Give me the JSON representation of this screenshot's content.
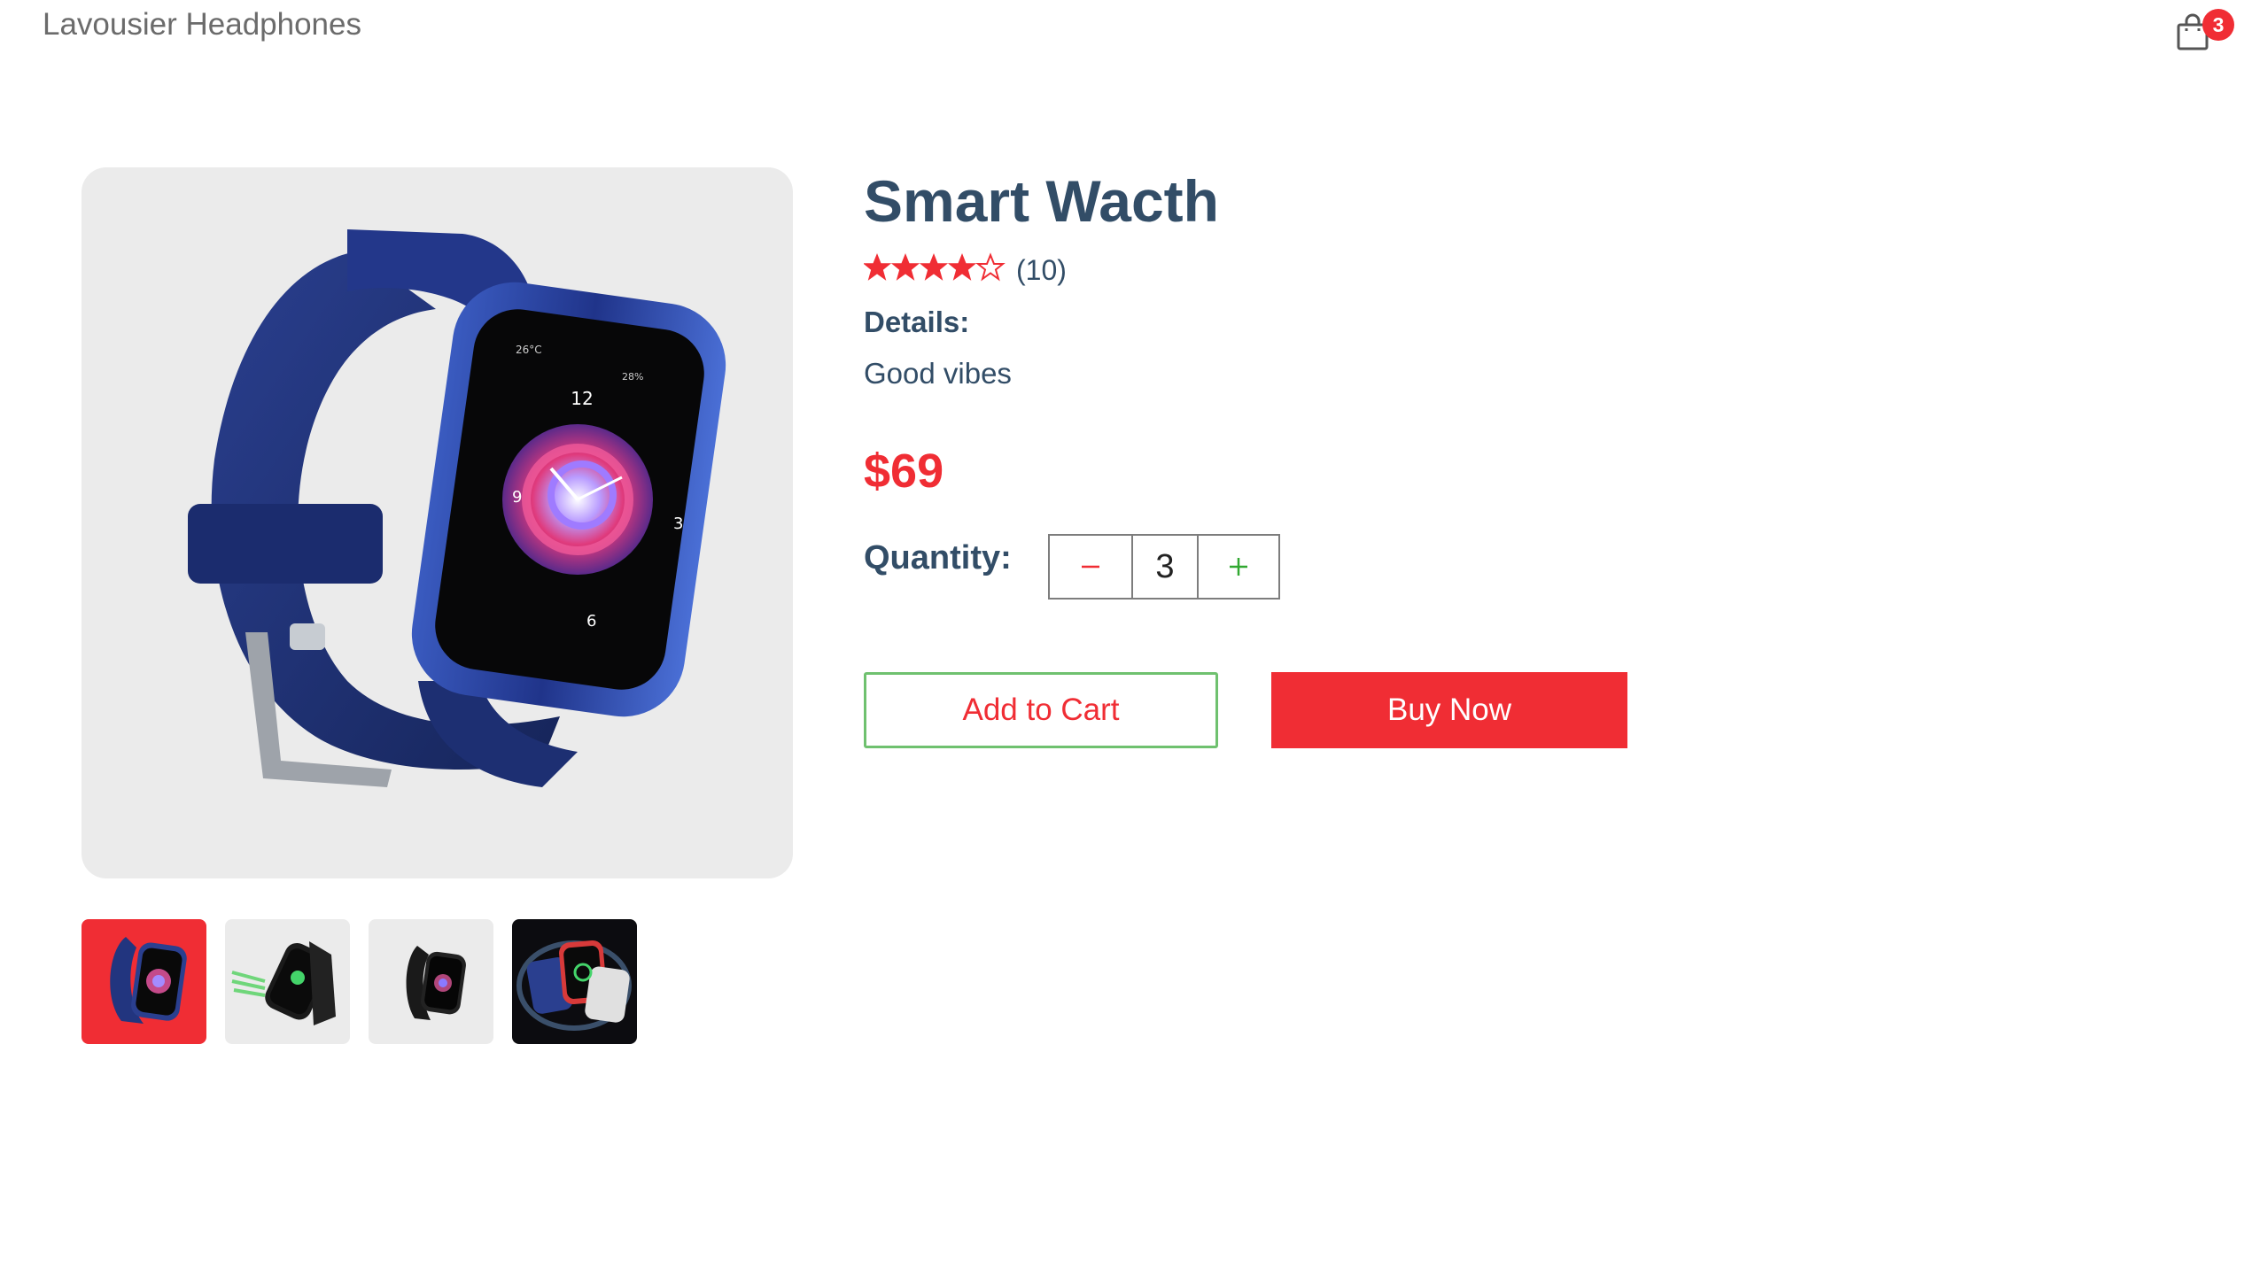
{
  "navbar": {
    "logo_text": "Lavousier Headphones",
    "cart_count": "3"
  },
  "product": {
    "name": "Smart Wacth",
    "rating": 4,
    "rating_max": 5,
    "review_count": "(10)",
    "details_heading": "Details:",
    "details_text": "Good vibes",
    "price": "$69",
    "quantity_label": "Quantity:",
    "quantity": "3"
  },
  "actions": {
    "add_to_cart": "Add to Cart",
    "buy_now": "Buy Now"
  },
  "gallery": {
    "selected_index": 0,
    "thumbnail_count": 4,
    "watch_face_numbers": [
      "12",
      "3",
      "6",
      "9"
    ],
    "watch_face_temp": "26°C",
    "watch_face_battery": "28%"
  },
  "colors": {
    "accent": "#f02d34",
    "heading": "#324d67",
    "add_to_cart_border": "#6fc16f",
    "image_background": "#ebebeb",
    "watch_strap": "#1d2f6f"
  }
}
